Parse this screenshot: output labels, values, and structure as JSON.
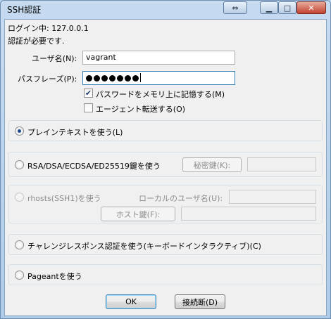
{
  "window": {
    "title": "SSH認証",
    "btn_restore": "⇔",
    "btn_minimize": "▁",
    "btn_maximize": "□",
    "btn_close": "✕"
  },
  "login": {
    "label": "ログイン中:",
    "host": "127.0.0.1",
    "message": "認証が必要です."
  },
  "form": {
    "username_label": "ユーザ名(N):",
    "username_value": "vagrant",
    "passphrase_label": "パスフレーズ(P):",
    "passphrase_mask_count": 7,
    "remember_label": "パスワードをメモリ上に記憶する(M)",
    "remember_checked": true,
    "agent_label": "エージェント転送する(O)",
    "agent_checked": false
  },
  "auth": {
    "plaintext_label": "プレインテキストを使う(L)",
    "rsa_label": "RSA/DSA/ECDSA/ED25519鍵を使う",
    "private_key_button": "秘密鍵(K):",
    "rhosts_label": "rhosts(SSH1)を使う",
    "local_user_label": "ローカルのユーザ名(U):",
    "host_key_button": "ホスト鍵(F):",
    "challenge_label": "チャレンジレスポンス認証を使う(キーボードインタラクティブ)(C)",
    "pageant_label": "Pageantを使う"
  },
  "buttons": {
    "ok": "OK",
    "disconnect": "接続断(D)"
  }
}
